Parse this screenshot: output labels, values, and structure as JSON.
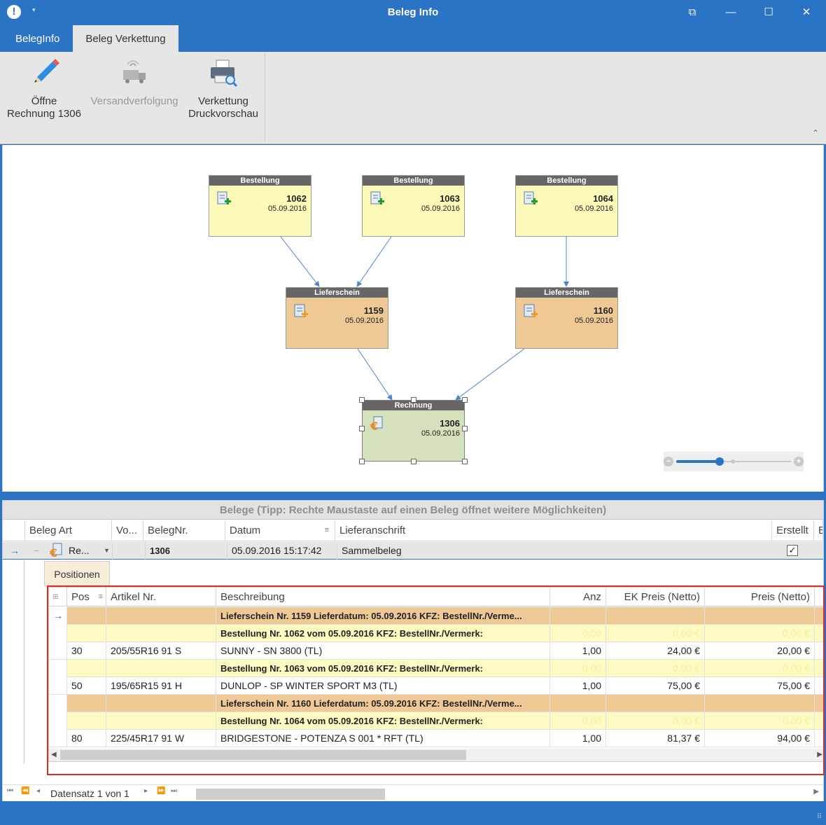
{
  "window": {
    "title": "Beleg Info",
    "app_icon": "!",
    "quick_access": "▾",
    "buttons": [
      "⧉",
      "—",
      "☐",
      "✕"
    ]
  },
  "tabs": [
    {
      "label": "BelegInfo",
      "active": false
    },
    {
      "label": "Beleg Verkettung",
      "active": true
    }
  ],
  "ribbon": {
    "open_invoice": {
      "line1": "Öffne",
      "line2": "Rechnung 1306"
    },
    "tracking": {
      "label": "Versandverfolgung"
    },
    "print_preview": {
      "line1": "Verkettung",
      "line2": "Druckvorschau"
    },
    "collapse": "⌃"
  },
  "diagram": {
    "nodes": [
      {
        "id": "b1062",
        "type": "Bestellung",
        "number": "1062",
        "date": "05.09.2016"
      },
      {
        "id": "b1063",
        "type": "Bestellung",
        "number": "1063",
        "date": "05.09.2016"
      },
      {
        "id": "b1064",
        "type": "Bestellung",
        "number": "1064",
        "date": "05.09.2016"
      },
      {
        "id": "l1159",
        "type": "Lieferschein",
        "number": "1159",
        "date": "05.09.2016"
      },
      {
        "id": "l1160",
        "type": "Lieferschein",
        "number": "1160",
        "date": "05.09.2016"
      },
      {
        "id": "r1306",
        "type": "Rechnung",
        "number": "1306",
        "date": "05.09.2016"
      }
    ],
    "zoom": {
      "minus": "−",
      "plus": "+",
      "level_fraction": 0.38
    }
  },
  "belege": {
    "group_header": "Belege (Tipp: Rechte Maustaste auf einen Beleg öffnet weitere Möglichkeiten)",
    "columns": [
      "Beleg Art",
      "Vo...",
      "BelegNr.",
      "Datum",
      "Lieferanschrift",
      "Erstellt",
      "E"
    ],
    "row": {
      "indicator": "→",
      "expand": "−",
      "art": "Re...",
      "vo": "",
      "belegnr": "1306",
      "datum": "05.09.2016 15:17:42",
      "lieferanschrift": "Sammelbeleg",
      "erstellt": "✓"
    }
  },
  "positionen": {
    "tab_label": "Positionen",
    "columns": [
      "Pos",
      "Artikel Nr.",
      "Beschreibung",
      "Anz",
      "EK Preis (Netto)",
      "Preis (Netto)"
    ],
    "rows": [
      {
        "kind": "lief",
        "indicator": "→",
        "pos": "",
        "artikel": "",
        "beschreibung": "Lieferschein Nr. 1159 Lieferdatum: 05.09.2016 KFZ:  BestellNr./Verme...",
        "anz": "",
        "ek": "",
        "preis": ""
      },
      {
        "kind": "best",
        "indicator": "",
        "pos": "",
        "artikel": "",
        "beschreibung": "Bestellung Nr. 1062 vom 05.09.2016 KFZ:  BestellNr./Vermerk:",
        "anz": "0,00",
        "ek": "0,00 €",
        "preis": "0,00 €"
      },
      {
        "kind": "item",
        "indicator": "",
        "pos": "30",
        "artikel": "205/55R16 91 S",
        "beschreibung": "SUNNY - SN 3800 (TL)",
        "anz": "1,00",
        "ek": "24,00 €",
        "preis": "20,00 €"
      },
      {
        "kind": "best",
        "indicator": "",
        "pos": "",
        "artikel": "",
        "beschreibung": "Bestellung Nr. 1063 vom 05.09.2016 KFZ:  BestellNr./Vermerk:",
        "anz": "0,00",
        "ek": "0,00 €",
        "preis": "0,00 €"
      },
      {
        "kind": "item",
        "indicator": "",
        "pos": "50",
        "artikel": "195/65R15 91 H",
        "beschreibung": "DUNLOP - SP WINTER SPORT M3 (TL)",
        "anz": "1,00",
        "ek": "75,00 €",
        "preis": "75,00 €"
      },
      {
        "kind": "lief",
        "indicator": "",
        "pos": "",
        "artikel": "",
        "beschreibung": "Lieferschein Nr. 1160 Lieferdatum: 05.09.2016 KFZ:  BestellNr./Verme...",
        "anz": "",
        "ek": "",
        "preis": ""
      },
      {
        "kind": "best",
        "indicator": "",
        "pos": "",
        "artikel": "",
        "beschreibung": "Bestellung Nr. 1064 vom 05.09.2016 KFZ:  BestellNr./Vermerk:",
        "anz": "0,00",
        "ek": "0,00 €",
        "preis": "0,00 €"
      },
      {
        "kind": "item",
        "indicator": "",
        "pos": "80",
        "artikel": "225/45R17 91 W",
        "beschreibung": "BRIDGESTONE - POTENZA S 001 * RFT (TL)",
        "anz": "1,00",
        "ek": "81,37 €",
        "preis": "94,00 €"
      }
    ]
  },
  "navigator": {
    "first": "⏮",
    "prev_page": "⏪",
    "prev": "◂",
    "next": "▸",
    "next_page": "⏩",
    "last": "⏭",
    "record_text": "Datensatz 1 von 1"
  },
  "colors": {
    "accent": "#2b73c4",
    "bestellung": "#fdfab9",
    "lieferschein": "#eec996",
    "rechnung": "#d5e1bd",
    "highlight": "#e02b2b"
  }
}
